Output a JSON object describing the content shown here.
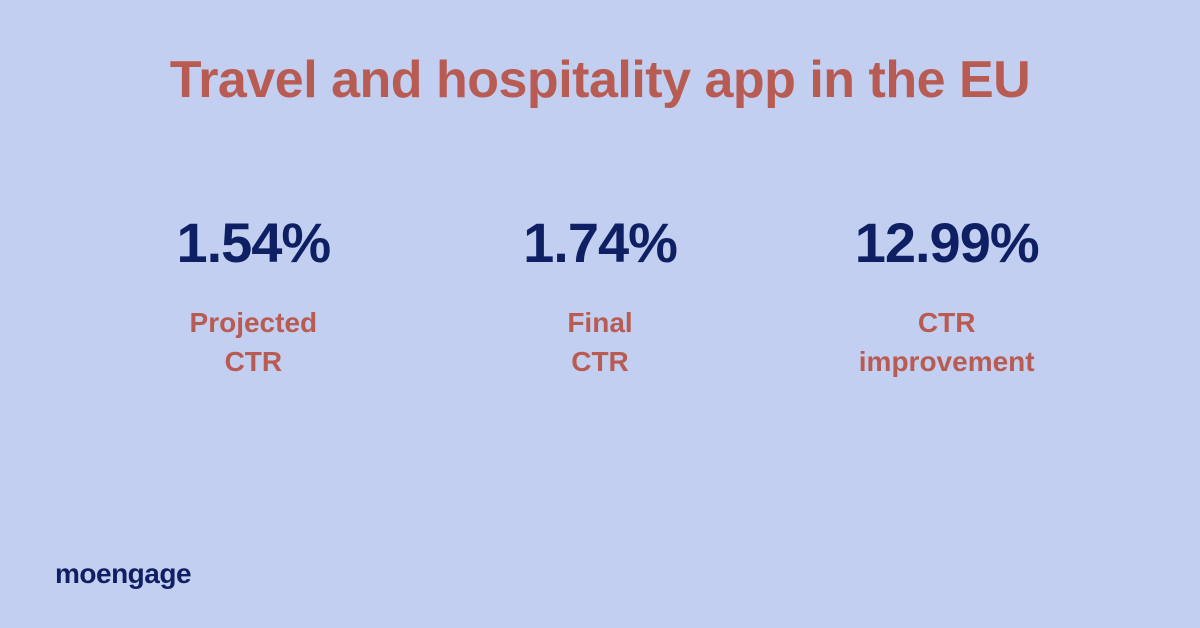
{
  "title": "Travel and hospitality app in the EU",
  "stats": [
    {
      "value": "1.54%",
      "label": "Projected\nCTR"
    },
    {
      "value": "1.74%",
      "label": "Final\nCTR"
    },
    {
      "value": "12.99%",
      "label": "CTR\nimprovement"
    }
  ],
  "logo": "moengage"
}
